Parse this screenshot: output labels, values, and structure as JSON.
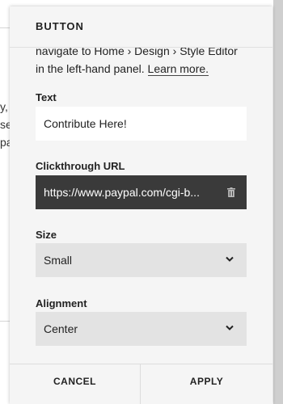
{
  "background": {
    "fragments": [
      "y, c",
      "se",
      "pa"
    ]
  },
  "panel": {
    "title": "BUTTON",
    "intro_clipped": "navigate to Home › Design › Style Editor",
    "intro_line2": "in the left-hand panel.",
    "learn_more": "Learn more."
  },
  "fields": {
    "text": {
      "label": "Text",
      "value": "Contribute Here!"
    },
    "url": {
      "label": "Clickthrough URL",
      "value": "https://www.paypal.com/cgi-b...",
      "icon": "trash-icon"
    },
    "size": {
      "label": "Size",
      "value": "Small",
      "icon": "chevron-down-icon"
    },
    "alignment": {
      "label": "Alignment",
      "value": "Center",
      "icon": "chevron-down-icon"
    }
  },
  "footer": {
    "cancel_label": "CANCEL",
    "apply_label": "APPLY"
  },
  "colors": {
    "panel_bg": "#f5f5f5",
    "url_bg": "#3a3a3a",
    "select_bg": "#e3e3e3"
  }
}
